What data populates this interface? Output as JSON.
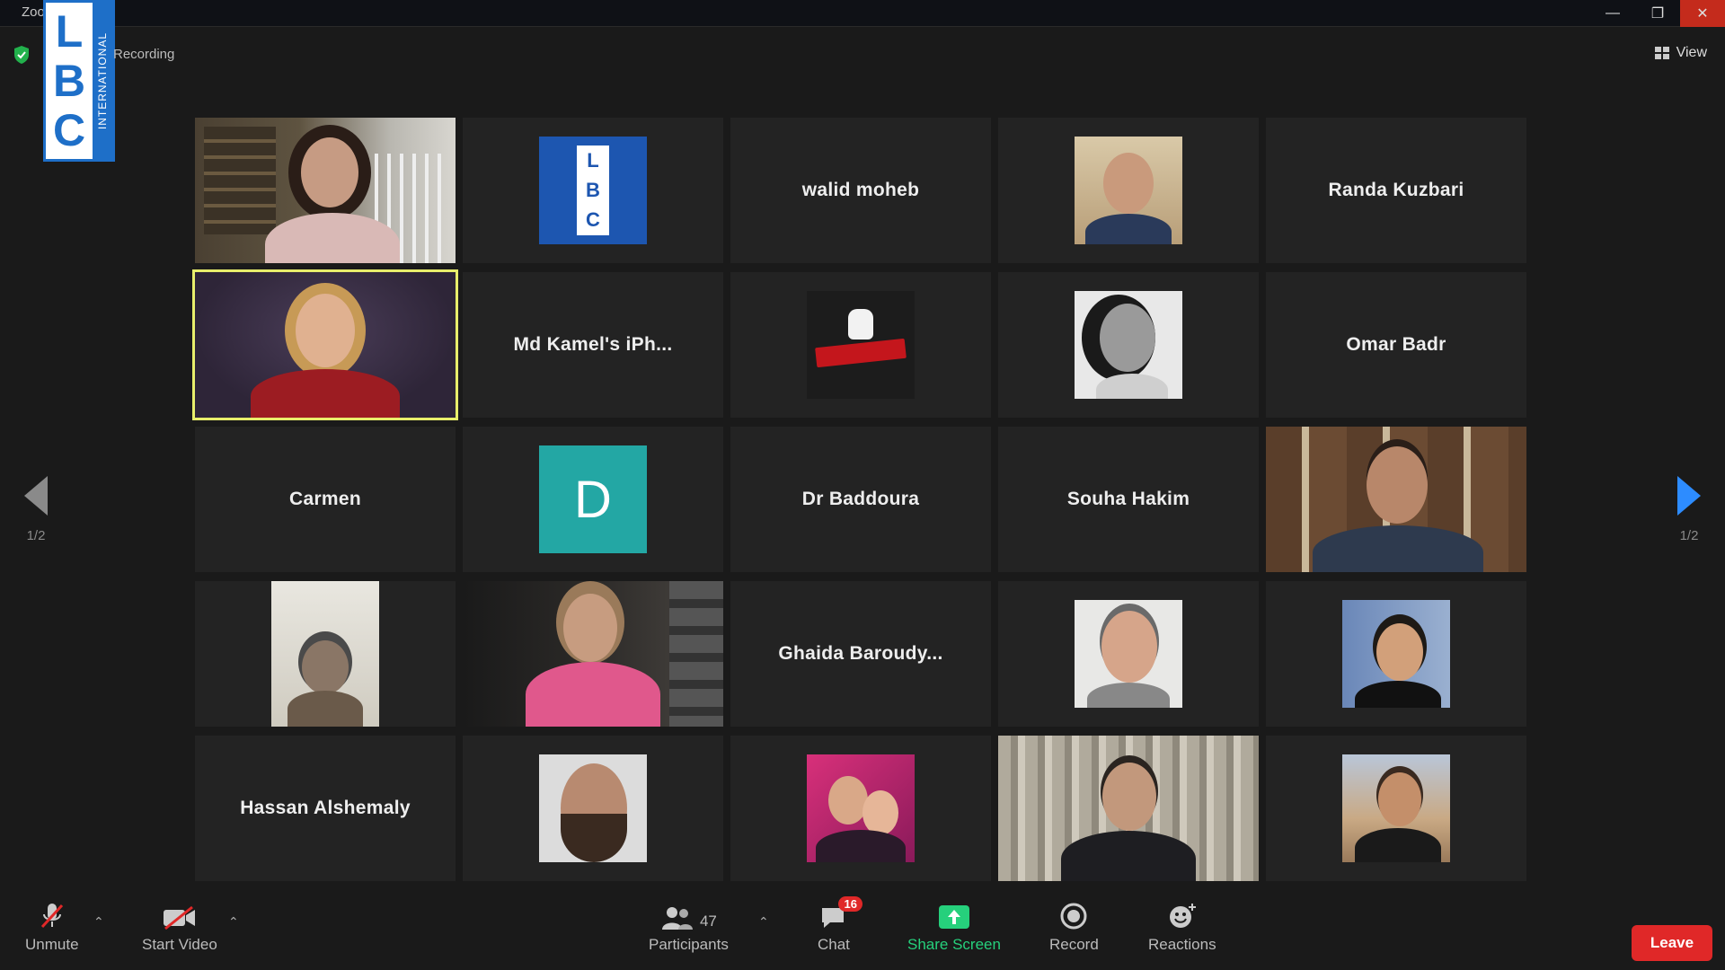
{
  "window": {
    "title": "Zoom Meeting",
    "controls": [
      "—",
      "❐",
      "✕"
    ]
  },
  "watermark": {
    "letters": [
      "L",
      "B",
      "C"
    ],
    "strip_text": "INTERNATIONAL"
  },
  "topbar": {
    "recording_label": "Recording",
    "view_label": "View"
  },
  "pager": {
    "left_indicator": "1/2",
    "right_indicator": "1/2"
  },
  "tiles": [
    {
      "name": "walid moheb"
    },
    {
      "name": "Randa Kuzbari"
    },
    {
      "name": "Md Kamel's iPh..."
    },
    {
      "name": "Omar Badr"
    },
    {
      "name": "Carmen"
    },
    {
      "name": "D"
    },
    {
      "name": "Dr Baddoura"
    },
    {
      "name": "Souha Hakim"
    },
    {
      "name": "Ghaida Baroudy..."
    },
    {
      "name": "Hassan Alshemaly"
    }
  ],
  "lbc_tile_letters": [
    "L",
    "B",
    "C"
  ],
  "toolbar": {
    "unmute": "Unmute",
    "start_video": "Start Video",
    "participants": "Participants",
    "participants_count": "47",
    "chat": "Chat",
    "chat_badge": "16",
    "share_screen": "Share Screen",
    "record": "Record",
    "reactions": "Reactions",
    "leave": "Leave"
  },
  "colors": {
    "active_speaker": "#e8ee6b",
    "accent": "#2d8cff",
    "share_green": "#26d07c",
    "leave_red": "#e02828",
    "avatar_teal": "#23a7a4"
  }
}
